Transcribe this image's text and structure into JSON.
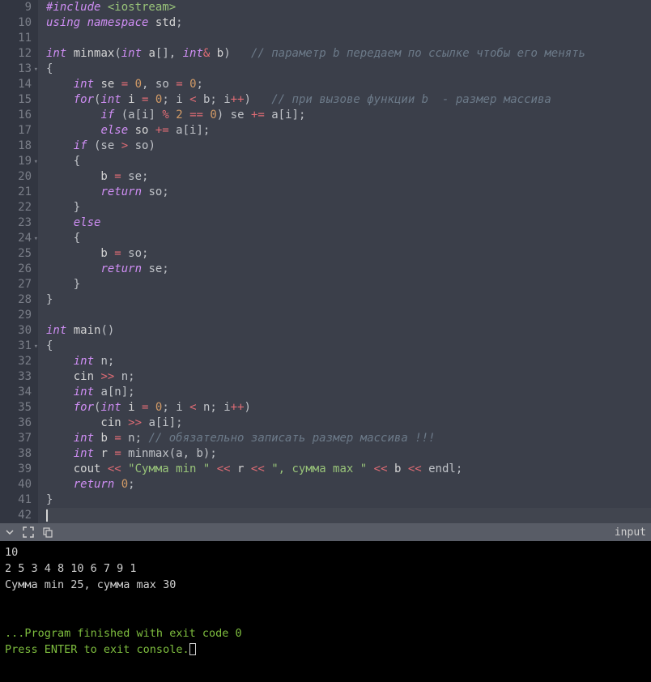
{
  "editor": {
    "first_line": 9,
    "lines": [
      {
        "n": 9,
        "fold": false,
        "tokens": [
          {
            "t": "#include ",
            "c": "pp"
          },
          {
            "t": "<iostream>",
            "c": "inc"
          }
        ]
      },
      {
        "n": 10,
        "fold": false,
        "tokens": [
          {
            "t": "using namespace",
            "c": "kw"
          },
          {
            "t": " std",
            "c": "id"
          },
          {
            "t": ";",
            "c": "punc"
          }
        ]
      },
      {
        "n": 11,
        "fold": false,
        "tokens": []
      },
      {
        "n": 12,
        "fold": false,
        "tokens": [
          {
            "t": "int",
            "c": "type"
          },
          {
            "t": " minmax",
            "c": "id"
          },
          {
            "t": "(",
            "c": "punc"
          },
          {
            "t": "int",
            "c": "type"
          },
          {
            "t": " a",
            "c": "id"
          },
          {
            "t": "[], ",
            "c": "punc"
          },
          {
            "t": "int",
            "c": "type"
          },
          {
            "t": "&",
            "c": "op"
          },
          {
            "t": " b",
            "c": "id"
          },
          {
            "t": ")   ",
            "c": "punc"
          },
          {
            "t": "// параметр b передаем по ссылке чтобы его менять",
            "c": "cmt"
          }
        ]
      },
      {
        "n": 13,
        "fold": true,
        "tokens": [
          {
            "t": "{",
            "c": "punc"
          }
        ]
      },
      {
        "n": 14,
        "fold": false,
        "tokens": [
          {
            "t": "    ",
            "c": ""
          },
          {
            "t": "int",
            "c": "type"
          },
          {
            "t": " se ",
            "c": "id"
          },
          {
            "t": "=",
            "c": "op"
          },
          {
            "t": " ",
            "c": ""
          },
          {
            "t": "0",
            "c": "num"
          },
          {
            "t": ", so ",
            "c": "punc"
          },
          {
            "t": "=",
            "c": "op"
          },
          {
            "t": " ",
            "c": ""
          },
          {
            "t": "0",
            "c": "num"
          },
          {
            "t": ";",
            "c": "punc"
          }
        ]
      },
      {
        "n": 15,
        "fold": false,
        "tokens": [
          {
            "t": "    ",
            "c": ""
          },
          {
            "t": "for",
            "c": "kw"
          },
          {
            "t": "(",
            "c": "punc"
          },
          {
            "t": "int",
            "c": "type"
          },
          {
            "t": " i ",
            "c": "id"
          },
          {
            "t": "=",
            "c": "op"
          },
          {
            "t": " ",
            "c": ""
          },
          {
            "t": "0",
            "c": "num"
          },
          {
            "t": "; i ",
            "c": "punc"
          },
          {
            "t": "<",
            "c": "op"
          },
          {
            "t": " b; i",
            "c": "punc"
          },
          {
            "t": "++",
            "c": "op"
          },
          {
            "t": ")   ",
            "c": "punc"
          },
          {
            "t": "// при вызове функции b  - размер массива",
            "c": "cmt"
          }
        ]
      },
      {
        "n": 16,
        "fold": false,
        "tokens": [
          {
            "t": "        ",
            "c": ""
          },
          {
            "t": "if",
            "c": "kw"
          },
          {
            "t": " (a[i] ",
            "c": "punc"
          },
          {
            "t": "%",
            "c": "op"
          },
          {
            "t": " ",
            "c": ""
          },
          {
            "t": "2",
            "c": "num"
          },
          {
            "t": " ",
            "c": ""
          },
          {
            "t": "==",
            "c": "op"
          },
          {
            "t": " ",
            "c": ""
          },
          {
            "t": "0",
            "c": "num"
          },
          {
            "t": ") se ",
            "c": "punc"
          },
          {
            "t": "+=",
            "c": "op"
          },
          {
            "t": " a[i];",
            "c": "punc"
          }
        ]
      },
      {
        "n": 17,
        "fold": false,
        "tokens": [
          {
            "t": "        ",
            "c": ""
          },
          {
            "t": "else",
            "c": "kw"
          },
          {
            "t": " so ",
            "c": "id"
          },
          {
            "t": "+=",
            "c": "op"
          },
          {
            "t": " a[i];",
            "c": "punc"
          }
        ]
      },
      {
        "n": 18,
        "fold": false,
        "tokens": [
          {
            "t": "    ",
            "c": ""
          },
          {
            "t": "if",
            "c": "kw"
          },
          {
            "t": " (se ",
            "c": "punc"
          },
          {
            "t": ">",
            "c": "op"
          },
          {
            "t": " so)",
            "c": "punc"
          }
        ]
      },
      {
        "n": 19,
        "fold": true,
        "tokens": [
          {
            "t": "    {",
            "c": "punc"
          }
        ]
      },
      {
        "n": 20,
        "fold": false,
        "tokens": [
          {
            "t": "        b ",
            "c": "id"
          },
          {
            "t": "=",
            "c": "op"
          },
          {
            "t": " se;",
            "c": "punc"
          }
        ]
      },
      {
        "n": 21,
        "fold": false,
        "tokens": [
          {
            "t": "        ",
            "c": ""
          },
          {
            "t": "return",
            "c": "kw"
          },
          {
            "t": " so;",
            "c": "punc"
          }
        ]
      },
      {
        "n": 22,
        "fold": false,
        "tokens": [
          {
            "t": "    }",
            "c": "punc"
          }
        ]
      },
      {
        "n": 23,
        "fold": false,
        "tokens": [
          {
            "t": "    ",
            "c": ""
          },
          {
            "t": "else",
            "c": "kw"
          }
        ]
      },
      {
        "n": 24,
        "fold": true,
        "tokens": [
          {
            "t": "    {",
            "c": "punc"
          }
        ]
      },
      {
        "n": 25,
        "fold": false,
        "tokens": [
          {
            "t": "        b ",
            "c": "id"
          },
          {
            "t": "=",
            "c": "op"
          },
          {
            "t": " so;",
            "c": "punc"
          }
        ]
      },
      {
        "n": 26,
        "fold": false,
        "tokens": [
          {
            "t": "        ",
            "c": ""
          },
          {
            "t": "return",
            "c": "kw"
          },
          {
            "t": " se;",
            "c": "punc"
          }
        ]
      },
      {
        "n": 27,
        "fold": false,
        "tokens": [
          {
            "t": "    }",
            "c": "punc"
          }
        ]
      },
      {
        "n": 28,
        "fold": false,
        "tokens": [
          {
            "t": "}",
            "c": "punc"
          }
        ]
      },
      {
        "n": 29,
        "fold": false,
        "tokens": []
      },
      {
        "n": 30,
        "fold": false,
        "tokens": [
          {
            "t": "int",
            "c": "type"
          },
          {
            "t": " main",
            "c": "id"
          },
          {
            "t": "()",
            "c": "punc"
          }
        ]
      },
      {
        "n": 31,
        "fold": true,
        "tokens": [
          {
            "t": "{",
            "c": "punc"
          }
        ]
      },
      {
        "n": 32,
        "fold": false,
        "tokens": [
          {
            "t": "    ",
            "c": ""
          },
          {
            "t": "int",
            "c": "type"
          },
          {
            "t": " n;",
            "c": "punc"
          }
        ]
      },
      {
        "n": 33,
        "fold": false,
        "tokens": [
          {
            "t": "    cin ",
            "c": "id"
          },
          {
            "t": ">>",
            "c": "op"
          },
          {
            "t": " n;",
            "c": "punc"
          }
        ]
      },
      {
        "n": 34,
        "fold": false,
        "tokens": [
          {
            "t": "    ",
            "c": ""
          },
          {
            "t": "int",
            "c": "type"
          },
          {
            "t": " a[n];",
            "c": "punc"
          }
        ]
      },
      {
        "n": 35,
        "fold": false,
        "tokens": [
          {
            "t": "    ",
            "c": ""
          },
          {
            "t": "for",
            "c": "kw"
          },
          {
            "t": "(",
            "c": "punc"
          },
          {
            "t": "int",
            "c": "type"
          },
          {
            "t": " i ",
            "c": "id"
          },
          {
            "t": "=",
            "c": "op"
          },
          {
            "t": " ",
            "c": ""
          },
          {
            "t": "0",
            "c": "num"
          },
          {
            "t": "; i ",
            "c": "punc"
          },
          {
            "t": "<",
            "c": "op"
          },
          {
            "t": " n; i",
            "c": "punc"
          },
          {
            "t": "++",
            "c": "op"
          },
          {
            "t": ")",
            "c": "punc"
          }
        ]
      },
      {
        "n": 36,
        "fold": false,
        "tokens": [
          {
            "t": "        cin ",
            "c": "id"
          },
          {
            "t": ">>",
            "c": "op"
          },
          {
            "t": " a[i];",
            "c": "punc"
          }
        ]
      },
      {
        "n": 37,
        "fold": false,
        "tokens": [
          {
            "t": "    ",
            "c": ""
          },
          {
            "t": "int",
            "c": "type"
          },
          {
            "t": " b ",
            "c": "id"
          },
          {
            "t": "=",
            "c": "op"
          },
          {
            "t": " n; ",
            "c": "punc"
          },
          {
            "t": "// обязательно записать размер массива !!!",
            "c": "cmt"
          }
        ]
      },
      {
        "n": 38,
        "fold": false,
        "tokens": [
          {
            "t": "    ",
            "c": ""
          },
          {
            "t": "int",
            "c": "type"
          },
          {
            "t": " r ",
            "c": "id"
          },
          {
            "t": "=",
            "c": "op"
          },
          {
            "t": " minmax(a, b);",
            "c": "punc"
          }
        ]
      },
      {
        "n": 39,
        "fold": false,
        "tokens": [
          {
            "t": "    cout ",
            "c": "id"
          },
          {
            "t": "<<",
            "c": "op"
          },
          {
            "t": " ",
            "c": ""
          },
          {
            "t": "\"Сумма min \"",
            "c": "str"
          },
          {
            "t": " ",
            "c": ""
          },
          {
            "t": "<<",
            "c": "op"
          },
          {
            "t": " r ",
            "c": "id"
          },
          {
            "t": "<<",
            "c": "op"
          },
          {
            "t": " ",
            "c": ""
          },
          {
            "t": "\", сумма max \"",
            "c": "str"
          },
          {
            "t": " ",
            "c": ""
          },
          {
            "t": "<<",
            "c": "op"
          },
          {
            "t": " b ",
            "c": "id"
          },
          {
            "t": "<<",
            "c": "op"
          },
          {
            "t": " endl;",
            "c": "punc"
          }
        ]
      },
      {
        "n": 40,
        "fold": false,
        "tokens": [
          {
            "t": "    ",
            "c": ""
          },
          {
            "t": "return",
            "c": "kw"
          },
          {
            "t": " ",
            "c": ""
          },
          {
            "t": "0",
            "c": "num"
          },
          {
            "t": ";",
            "c": "punc"
          }
        ]
      },
      {
        "n": 41,
        "fold": false,
        "tokens": [
          {
            "t": "}",
            "c": "punc"
          }
        ]
      },
      {
        "n": 42,
        "fold": false,
        "cursor": true,
        "tokens": []
      }
    ]
  },
  "terminal_bar": {
    "label": "input"
  },
  "terminal": {
    "lines": [
      {
        "text": "10",
        "class": ""
      },
      {
        "text": "2 5 3 4 8 10 6 7 9 1",
        "class": ""
      },
      {
        "text": "Сумма min 25, сумма max 30",
        "class": ""
      },
      {
        "text": "",
        "class": ""
      },
      {
        "text": "",
        "class": ""
      },
      {
        "text": "...Program finished with exit code 0",
        "class": "green"
      },
      {
        "text_prefix": "Press ENTER to exit console.",
        "class": "green",
        "cursor": true
      }
    ]
  }
}
